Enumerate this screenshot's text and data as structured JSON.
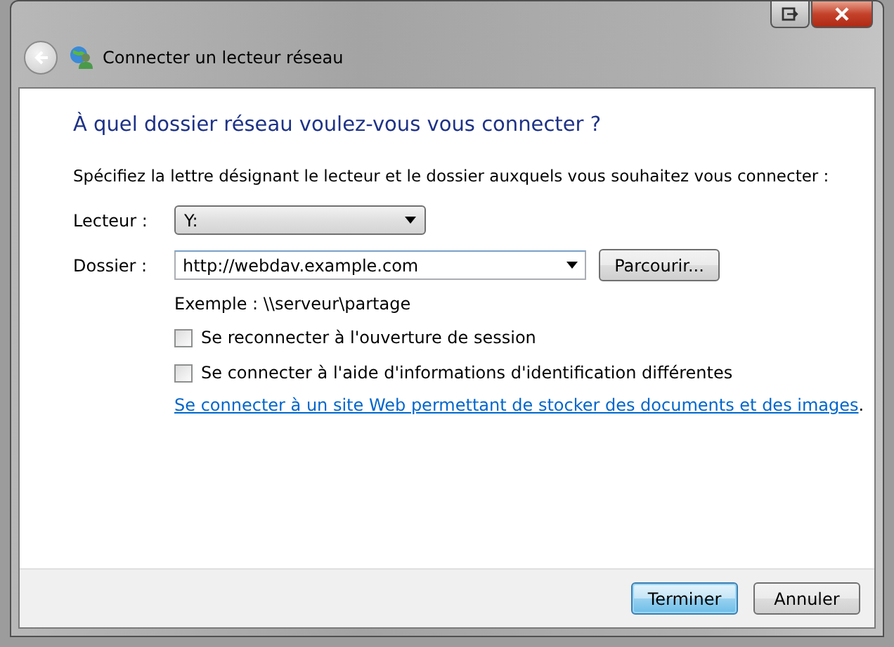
{
  "window": {
    "title": "Connecter un lecteur réseau"
  },
  "heading": "À quel dossier réseau voulez-vous vous connecter ?",
  "instruction": "Spécifiez la lettre désignant le lecteur et le dossier auxquels vous souhaitez vous connecter :",
  "fields": [
    {
      "kind": "dropdown",
      "label": "Lecteur :",
      "value": "Y:"
    },
    {
      "kind": "combo",
      "label": "Dossier :",
      "value": "http://webdav.example.com",
      "button": "Parcourir..."
    }
  ],
  "example": "Exemple : \\\\serveur\\partage",
  "options": [
    {
      "label": "Se reconnecter à l'ouverture de session",
      "checked": false
    },
    {
      "label": "Se connecter à l'aide d'informations d'identification différentes",
      "checked": false
    }
  ],
  "link_sentence": {
    "link": "Se connecter à un site Web permettant de stocker des documents et des images",
    "after": "."
  },
  "buttons": [
    {
      "label": "Terminer",
      "default": true
    },
    {
      "label": "Annuler",
      "default": false
    }
  ]
}
